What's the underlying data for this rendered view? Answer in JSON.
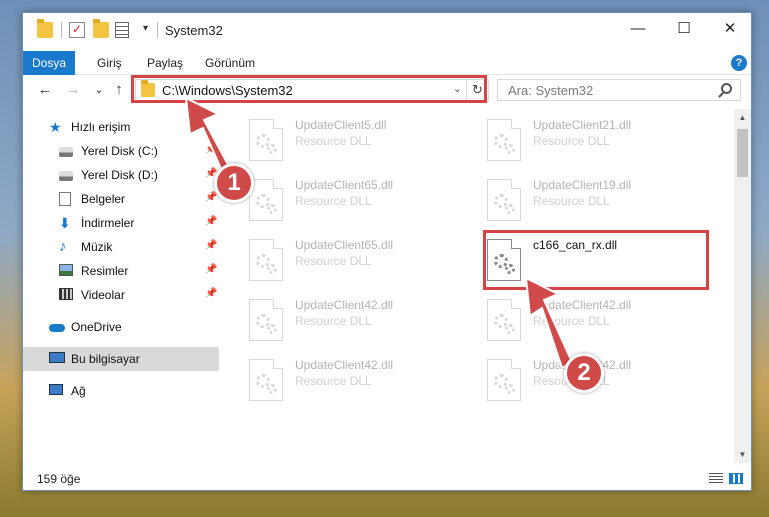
{
  "window": {
    "title": "System32",
    "minimize": "—",
    "maximize": "☐",
    "close": "✕"
  },
  "ribbon": {
    "tabs": [
      "Dosya",
      "Giriş",
      "Paylaş",
      "Görünüm"
    ],
    "help": "?"
  },
  "nav": {
    "back": "←",
    "forward": "→",
    "recent": "⌄",
    "up": "↑",
    "address": "C:\\Windows\\System32",
    "refresh": "↻",
    "search_placeholder": "Ara: System32"
  },
  "sidebar": {
    "items": [
      {
        "label": "Hızlı erişim",
        "icon": "star-icon"
      },
      {
        "label": "Yerel Disk (C:)",
        "icon": "disk-icon",
        "pinned": true
      },
      {
        "label": "Yerel Disk (D:)",
        "icon": "disk-icon",
        "pinned": true
      },
      {
        "label": "Belgeler",
        "icon": "document-icon",
        "pinned": true
      },
      {
        "label": "İndirmeler",
        "icon": "download-icon",
        "pinned": true
      },
      {
        "label": "Müzik",
        "icon": "music-icon",
        "pinned": true
      },
      {
        "label": "Resimler",
        "icon": "picture-icon",
        "pinned": true
      },
      {
        "label": "Videolar",
        "icon": "video-icon",
        "pinned": true
      },
      {
        "label": "OneDrive",
        "icon": "cloud-icon"
      },
      {
        "label": "Bu bilgisayar",
        "icon": "computer-icon",
        "selected": true
      },
      {
        "label": "Ağ",
        "icon": "network-icon"
      }
    ]
  },
  "files": [
    {
      "name": "UpdateClient5.dll",
      "type": "Resource DLL",
      "faded": true
    },
    {
      "name": "UpdateClient21.dll",
      "type": "Resource DLL",
      "faded": true
    },
    {
      "name": "UpdateClient65.dll",
      "type": "Resource DLL",
      "faded": true
    },
    {
      "name": "UpdateClient19.dll",
      "type": "Resource DLL",
      "faded": true
    },
    {
      "name": "UpdateClient65.dll",
      "type": "Resource DLL",
      "faded": true
    },
    {
      "name": "c166_can_rx.dll",
      "type": "",
      "faded": false
    },
    {
      "name": "UpdateClient42.dll",
      "type": "Resource DLL",
      "faded": true
    },
    {
      "name": "UpdateClient42.dll",
      "type": "Resource DLL",
      "faded": true
    },
    {
      "name": "UpdateClient42.dll",
      "type": "Resource DLL",
      "faded": true
    },
    {
      "name": "UpdateClient42.dll",
      "type": "Resource DLL",
      "faded": true
    }
  ],
  "status": {
    "item_count": "159 öğe"
  },
  "annotations": {
    "step1": "1",
    "step2": "2",
    "color": "#d04a4a"
  }
}
